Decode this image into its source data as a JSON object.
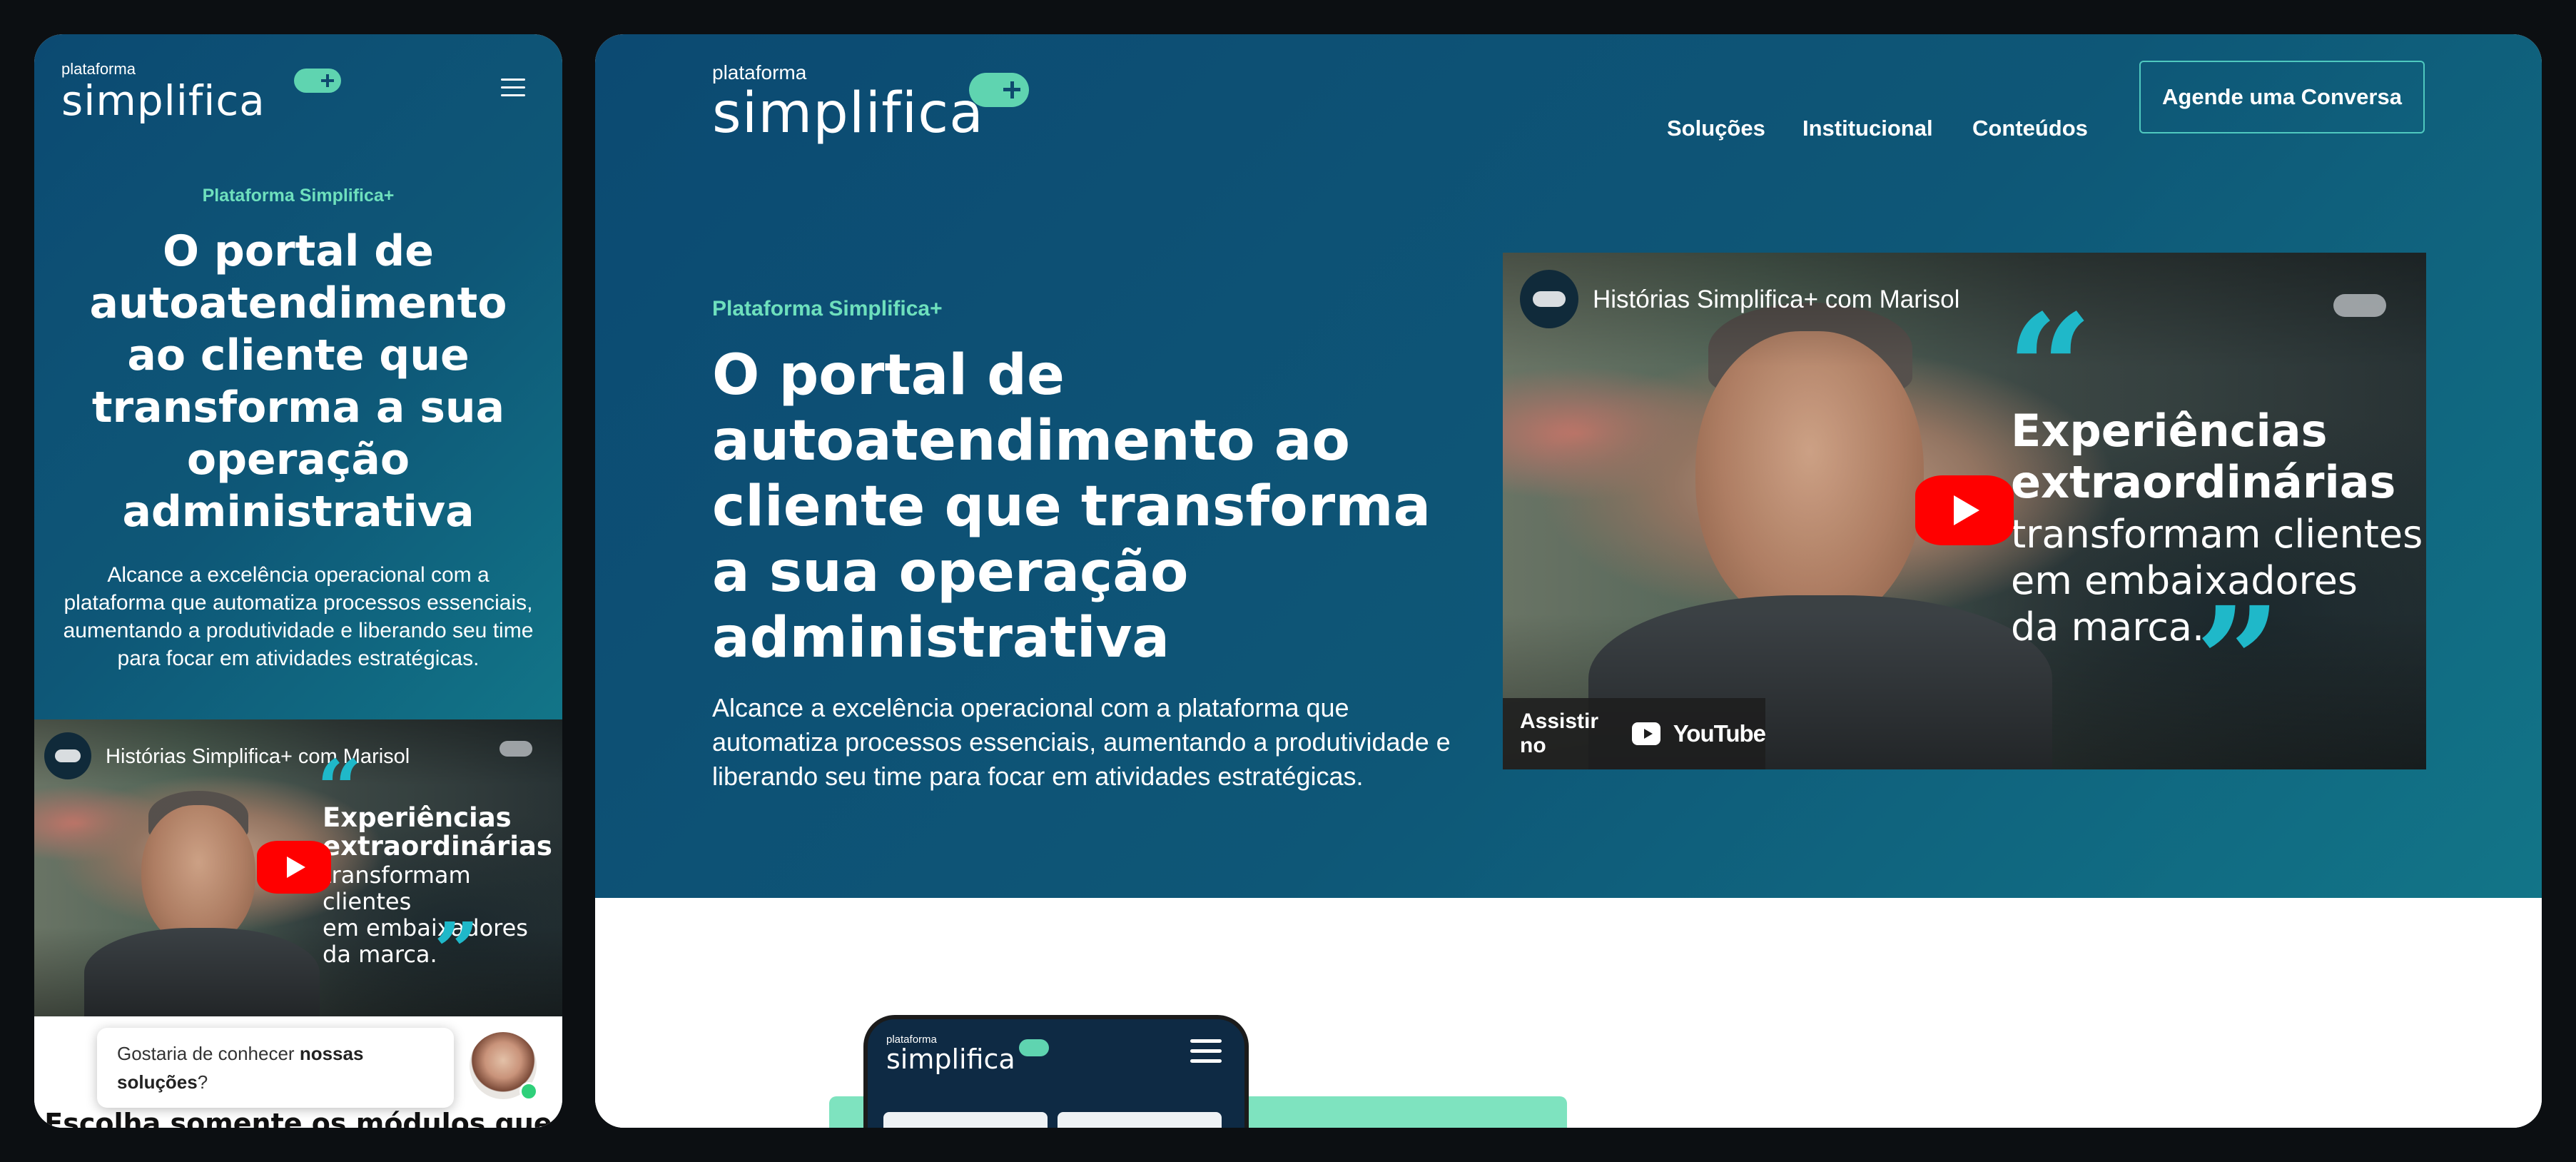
{
  "brand": {
    "logo_small": "plataforma",
    "logo_big": "simplifica",
    "accent_green": "#6ee0bd",
    "hero_blue": "#0c4a72"
  },
  "nav": {
    "items": [
      {
        "label": "Soluções"
      },
      {
        "label": "Institucional"
      },
      {
        "label": "Conteúdos"
      }
    ],
    "cta_label": "Agende uma Conversa"
  },
  "hero": {
    "eyebrow": "Plataforma Simplifica+",
    "title": "O portal de autoatendimento ao cliente que transforma a sua operação administrativa",
    "description": "Alcance a excelência operacional com a plataforma que automatiza processos essenciais, aumentando a produtividade e liberando seu time para focar em atividades estratégicas."
  },
  "video": {
    "title": "Histórias Simplifica+ com Marisol",
    "quote_open": "“",
    "quote_close": "”",
    "overlay_bold_1": "Experiências",
    "overlay_bold_2": "extraordinárias",
    "overlay_light_1": "transformam clientes",
    "overlay_light_2": "em embaixadores",
    "overlay_light_3": "da marca.",
    "watch_on": "Assistir no",
    "youtube": "YouTube"
  },
  "chat": {
    "text_before": "Gostaria de conhecer ",
    "text_bold": "nossas soluções",
    "text_after": "?"
  },
  "mobile": {
    "cut_heading": "Escolha somente os módulos que"
  }
}
